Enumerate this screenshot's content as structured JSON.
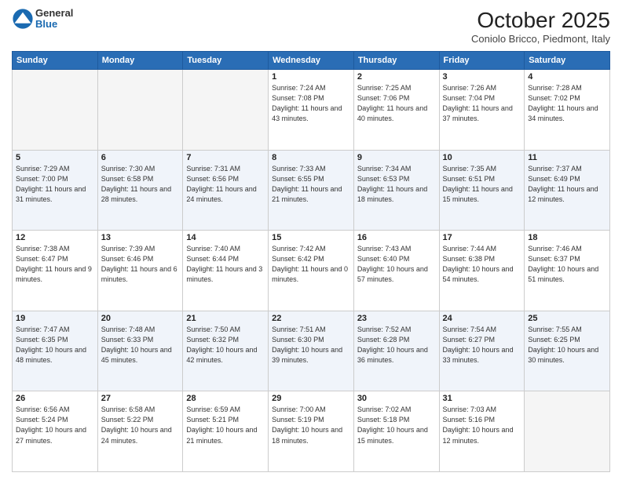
{
  "logo": {
    "general": "General",
    "blue": "Blue"
  },
  "header": {
    "title": "October 2025",
    "location": "Coniolo Bricco, Piedmont, Italy"
  },
  "days_of_week": [
    "Sunday",
    "Monday",
    "Tuesday",
    "Wednesday",
    "Thursday",
    "Friday",
    "Saturday"
  ],
  "weeks": [
    [
      {
        "day": "",
        "empty": true
      },
      {
        "day": "",
        "empty": true
      },
      {
        "day": "",
        "empty": true
      },
      {
        "day": "1",
        "sunrise": "7:24 AM",
        "sunset": "7:08 PM",
        "daylight": "11 hours and 43 minutes."
      },
      {
        "day": "2",
        "sunrise": "7:25 AM",
        "sunset": "7:06 PM",
        "daylight": "11 hours and 40 minutes."
      },
      {
        "day": "3",
        "sunrise": "7:26 AM",
        "sunset": "7:04 PM",
        "daylight": "11 hours and 37 minutes."
      },
      {
        "day": "4",
        "sunrise": "7:28 AM",
        "sunset": "7:02 PM",
        "daylight": "11 hours and 34 minutes."
      }
    ],
    [
      {
        "day": "5",
        "sunrise": "7:29 AM",
        "sunset": "7:00 PM",
        "daylight": "11 hours and 31 minutes."
      },
      {
        "day": "6",
        "sunrise": "7:30 AM",
        "sunset": "6:58 PM",
        "daylight": "11 hours and 28 minutes."
      },
      {
        "day": "7",
        "sunrise": "7:31 AM",
        "sunset": "6:56 PM",
        "daylight": "11 hours and 24 minutes."
      },
      {
        "day": "8",
        "sunrise": "7:33 AM",
        "sunset": "6:55 PM",
        "daylight": "11 hours and 21 minutes."
      },
      {
        "day": "9",
        "sunrise": "7:34 AM",
        "sunset": "6:53 PM",
        "daylight": "11 hours and 18 minutes."
      },
      {
        "day": "10",
        "sunrise": "7:35 AM",
        "sunset": "6:51 PM",
        "daylight": "11 hours and 15 minutes."
      },
      {
        "day": "11",
        "sunrise": "7:37 AM",
        "sunset": "6:49 PM",
        "daylight": "11 hours and 12 minutes."
      }
    ],
    [
      {
        "day": "12",
        "sunrise": "7:38 AM",
        "sunset": "6:47 PM",
        "daylight": "11 hours and 9 minutes."
      },
      {
        "day": "13",
        "sunrise": "7:39 AM",
        "sunset": "6:46 PM",
        "daylight": "11 hours and 6 minutes."
      },
      {
        "day": "14",
        "sunrise": "7:40 AM",
        "sunset": "6:44 PM",
        "daylight": "11 hours and 3 minutes."
      },
      {
        "day": "15",
        "sunrise": "7:42 AM",
        "sunset": "6:42 PM",
        "daylight": "11 hours and 0 minutes."
      },
      {
        "day": "16",
        "sunrise": "7:43 AM",
        "sunset": "6:40 PM",
        "daylight": "10 hours and 57 minutes."
      },
      {
        "day": "17",
        "sunrise": "7:44 AM",
        "sunset": "6:38 PM",
        "daylight": "10 hours and 54 minutes."
      },
      {
        "day": "18",
        "sunrise": "7:46 AM",
        "sunset": "6:37 PM",
        "daylight": "10 hours and 51 minutes."
      }
    ],
    [
      {
        "day": "19",
        "sunrise": "7:47 AM",
        "sunset": "6:35 PM",
        "daylight": "10 hours and 48 minutes."
      },
      {
        "day": "20",
        "sunrise": "7:48 AM",
        "sunset": "6:33 PM",
        "daylight": "10 hours and 45 minutes."
      },
      {
        "day": "21",
        "sunrise": "7:50 AM",
        "sunset": "6:32 PM",
        "daylight": "10 hours and 42 minutes."
      },
      {
        "day": "22",
        "sunrise": "7:51 AM",
        "sunset": "6:30 PM",
        "daylight": "10 hours and 39 minutes."
      },
      {
        "day": "23",
        "sunrise": "7:52 AM",
        "sunset": "6:28 PM",
        "daylight": "10 hours and 36 minutes."
      },
      {
        "day": "24",
        "sunrise": "7:54 AM",
        "sunset": "6:27 PM",
        "daylight": "10 hours and 33 minutes."
      },
      {
        "day": "25",
        "sunrise": "7:55 AM",
        "sunset": "6:25 PM",
        "daylight": "10 hours and 30 minutes."
      }
    ],
    [
      {
        "day": "26",
        "sunrise": "6:56 AM",
        "sunset": "5:24 PM",
        "daylight": "10 hours and 27 minutes."
      },
      {
        "day": "27",
        "sunrise": "6:58 AM",
        "sunset": "5:22 PM",
        "daylight": "10 hours and 24 minutes."
      },
      {
        "day": "28",
        "sunrise": "6:59 AM",
        "sunset": "5:21 PM",
        "daylight": "10 hours and 21 minutes."
      },
      {
        "day": "29",
        "sunrise": "7:00 AM",
        "sunset": "5:19 PM",
        "daylight": "10 hours and 18 minutes."
      },
      {
        "day": "30",
        "sunrise": "7:02 AM",
        "sunset": "5:18 PM",
        "daylight": "10 hours and 15 minutes."
      },
      {
        "day": "31",
        "sunrise": "7:03 AM",
        "sunset": "5:16 PM",
        "daylight": "10 hours and 12 minutes."
      },
      {
        "day": "",
        "empty": true
      }
    ]
  ]
}
